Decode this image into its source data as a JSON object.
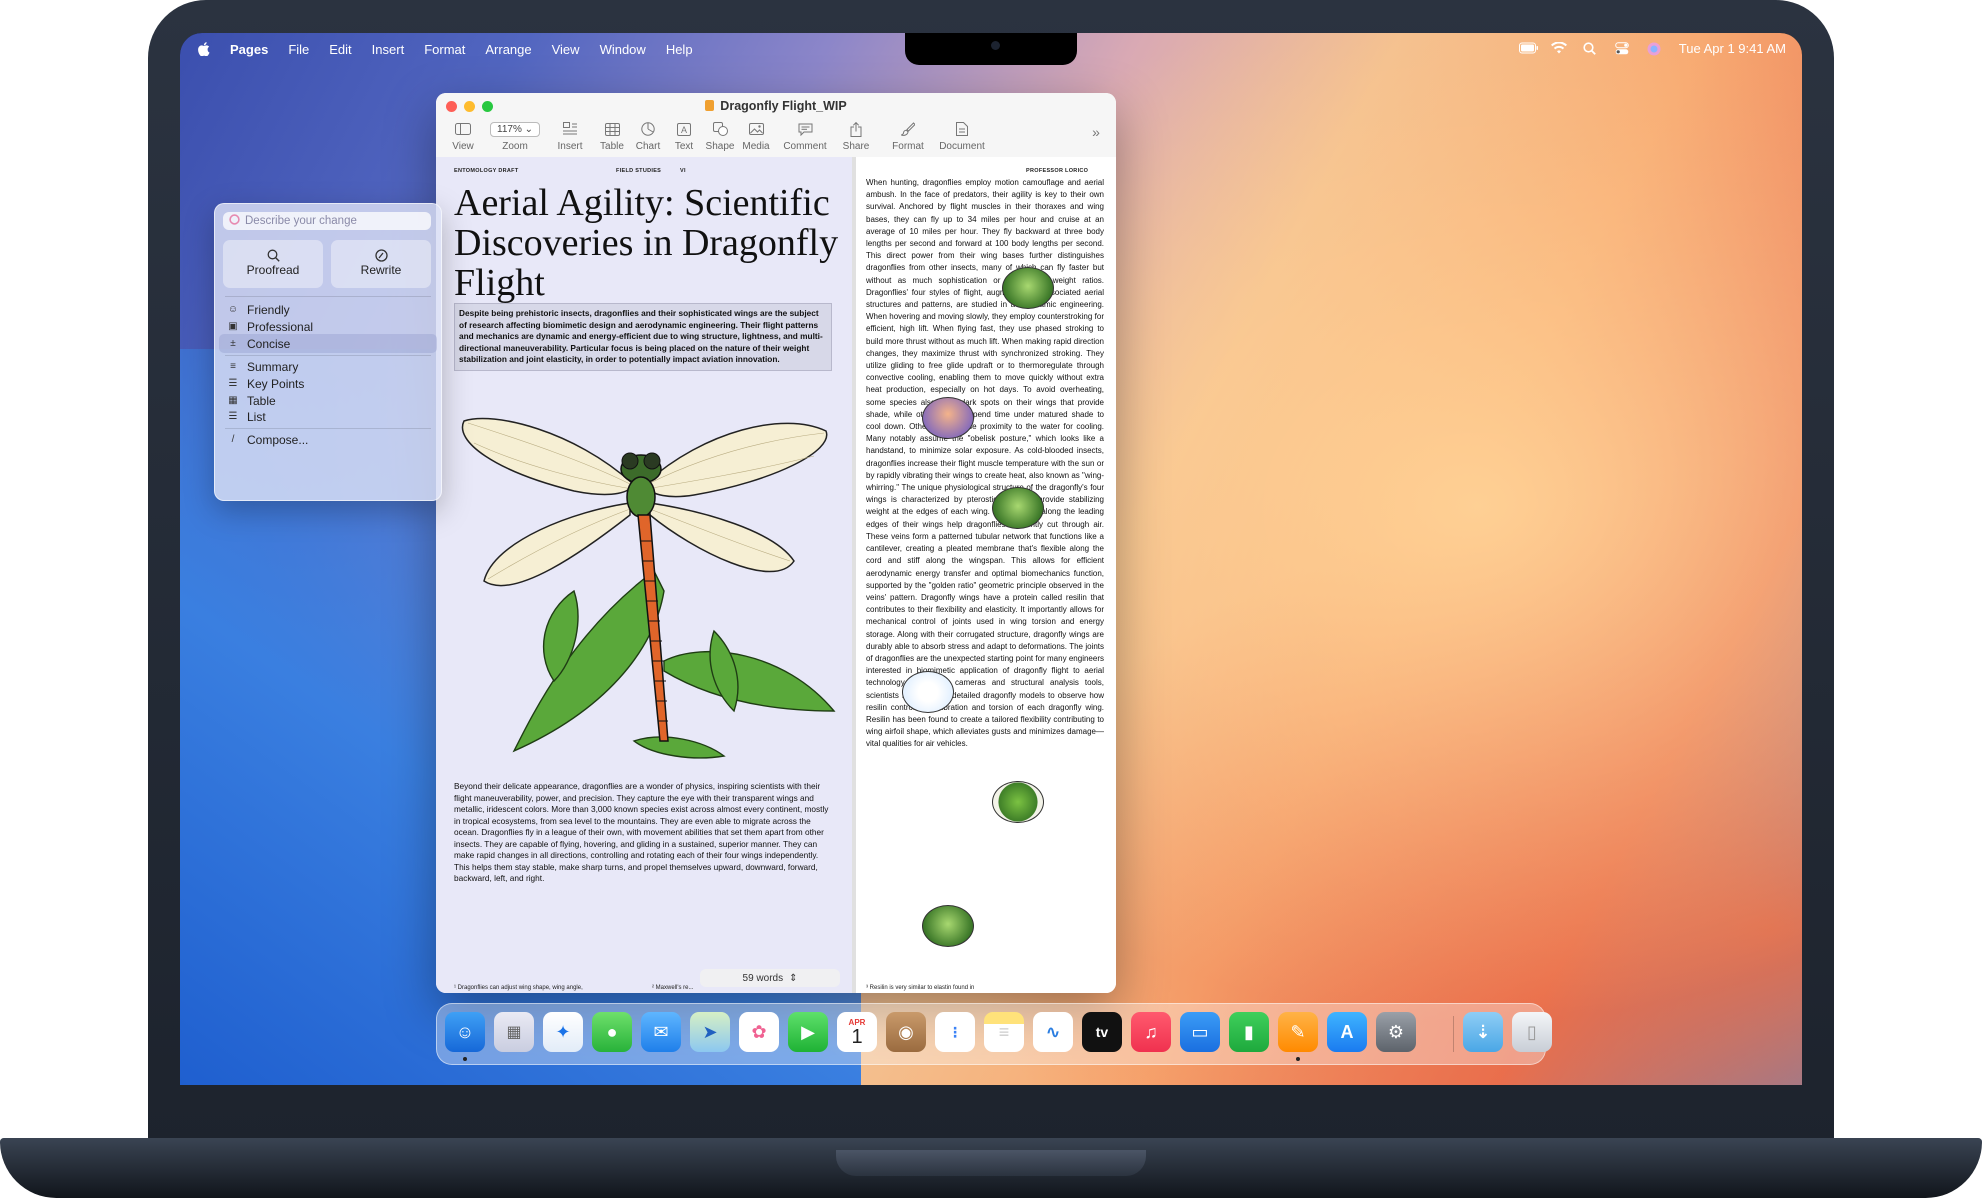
{
  "menubar": {
    "apple": "",
    "items": [
      "Pages",
      "File",
      "Edit",
      "Insert",
      "Format",
      "Arrange",
      "View",
      "Window",
      "Help"
    ],
    "clock": "Tue Apr 1  9:41 AM"
  },
  "window": {
    "title": "Dragonfly Flight_WIP",
    "zoom": "117%",
    "toolbar": [
      "View",
      "Zoom",
      "Insert",
      "Table",
      "Chart",
      "Text",
      "Shape",
      "Media",
      "Comment",
      "Share",
      "Format",
      "Document"
    ]
  },
  "document": {
    "header_left": "ENTOMOLOGY DRAFT",
    "header_mid": "FIELD STUDIES",
    "header_num": "VI",
    "header_right": "PROFESSOR LORICO",
    "headline": "Aerial Agility: Scientific Discoveries in Dragonfly Flight",
    "intro": "Despite being prehistoric insects, dragonflies and their sophisticated wings are the subject of research affecting biomimetic design and aerodynamic engineering. Their flight patterns and mechanics are dynamic and energy-efficient due to wing structure, lightness, and multi-directional maneuverability. Particular focus is being placed on the nature of their weight stabilization and joint elasticity, in order to potentially impact aviation innovation.",
    "body_left": "Beyond their delicate appearance, dragonflies are a wonder of physics, inspiring scientists with their flight maneuverability, power, and precision. They capture the eye with their transparent wings and metallic, iridescent colors. More than 3,000 known species exist across almost every continent, mostly in tropical ecosystems, from sea level to the mountains. They are even able to migrate across the ocean. Dragonflies fly in a league of their own, with movement abilities that set them apart from other insects. They are capable of flying, hovering, and gliding in a sustained, superior manner. They can make rapid changes in all directions, controlling and rotating each of their four wings independently. This helps them stay stable, make sharp turns, and propel themselves upward, downward, forward, backward, left, and right.",
    "body_right": "When hunting, dragonflies employ motion camouflage and aerial ambush. In the face of predators, their agility is key to their own survival. Anchored by flight muscles in their thoraxes and wing bases, they can fly up to 34 miles per hour and cruise at an average of 10 miles per hour. They fly backward at three body lengths per second and forward at 100 body lengths per second. This direct power from their wing bases further distinguishes dragonflies from other insects, many of which can fly faster but without as much sophistication or high power-weight ratios. Dragonflies' four styles of flight, augmented by associated aerial structures and patterns, are studied in aerodynamic engineering. When hovering and moving slowly, they employ counterstroking for efficient, high lift. When flying fast, they use phased stroking to build more thrust without as much lift. When making rapid direction changes, they maximize thrust with synchronized stroking. They utilize gliding to free glide updraft or to thermoregulate through convective cooling, enabling them to move quickly without extra heat production, especially on hot days. To avoid overheating, some species also have dark spots on their wings that provide shade, while others simply spend time under matured shade to cool down. Others fly in close proximity to the water for cooling. Many notably assume the \"obelisk posture,\" which looks like a handstand, to minimize solar exposure. As cold-blooded insects, dragonflies increase their flight muscle temperature with the sun or by rapidly vibrating their wings to create heat, also known as \"wing-whirring.\" The unique physiological structure of the dragonfly's four wings is characterized by pterostigmata that provide stabilizing weight at the edges of each wing. Strong veins along the leading edges of their wings help dragonflies efficiently cut through air. These veins form a patterned tubular network that functions like a cantilever, creating a pleated membrane that's flexible along the cord and stiff along the wingspan. This allows for efficient aerodynamic energy transfer and optimal biomechanics function, supported by the \"golden ratio\" geometric principle observed in the veins' pattern. Dragonfly wings have a protein called resilin that contributes to their flexibility and elasticity. It importantly allows for mechanical control of joints used in wing torsion and energy storage. Along with their corrugated structure, dragonfly wings are durably able to absorb stress and adapt to deformations. The joints of dragonflies are the unexpected starting point for many engineers interested in biomimetic application of dragonfly flight to aerial technology. Using 4D cameras and structural analysis tools, scientists have created detailed dragonfly models to observe how resilin controls the vibration and torsion of each dragonfly wing. Resilin has been found to create a tailored flexibility contributing to wing airfoil shape, which alleviates gusts and minimizes damage—vital qualities for air vehicles.",
    "footnote_left": "¹ Dragonflies can adjust wing shape, wing angle,",
    "footnote_mid": "² Maxwell's re...",
    "footnote_right": "³ Resilin is very similar to elastin found in",
    "word_count": "59 words"
  },
  "writing_tools": {
    "placeholder": "Describe your change",
    "proofread": "Proofread",
    "rewrite": "Rewrite",
    "tones": [
      "Friendly",
      "Professional",
      "Concise"
    ],
    "selected": "Concise",
    "formats": [
      "Summary",
      "Key Points",
      "Table",
      "List"
    ],
    "compose": "Compose..."
  },
  "dock": {
    "apps": [
      "Finder",
      "Launchpad",
      "Safari",
      "Messages",
      "Mail",
      "Maps",
      "Photos",
      "FaceTime",
      "Calendar",
      "Contacts",
      "Reminders",
      "Notes",
      "Freeform",
      "TV",
      "Music",
      "Keynote",
      "Numbers",
      "Pages",
      "App Store",
      "System Settings",
      "Downloads",
      "Trash"
    ],
    "calendar_month": "APR",
    "calendar_day": "1",
    "tv_label": "tv"
  }
}
